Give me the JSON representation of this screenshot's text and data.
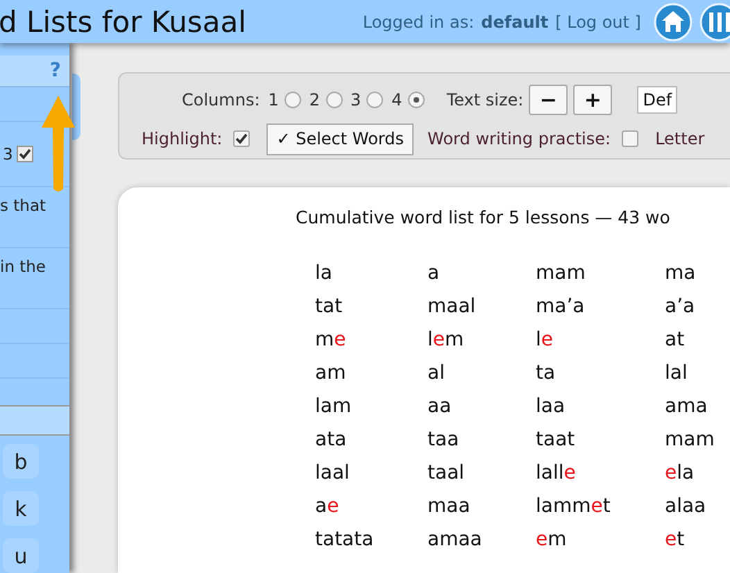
{
  "header": {
    "title": "d Lists for Kusaal",
    "login_label": "Logged in as:",
    "user": "default",
    "logout": "[ Log out ]"
  },
  "sidebar": {
    "help": "?",
    "rows": [
      {
        "kind": "blank"
      },
      {
        "kind": "checkbox",
        "label": "3",
        "checked": true
      },
      {
        "kind": "text",
        "label": "s that"
      },
      {
        "kind": "text",
        "label": "in the"
      },
      {
        "kind": "blank"
      },
      {
        "kind": "blank"
      },
      {
        "kind": "band"
      }
    ],
    "letters": [
      "b",
      "k",
      "u"
    ]
  },
  "toolbar": {
    "columns_label": "Columns:",
    "columns": [
      {
        "label": "1",
        "selected": false
      },
      {
        "label": "2",
        "selected": false
      },
      {
        "label": "3",
        "selected": false
      },
      {
        "label": "4",
        "selected": true
      }
    ],
    "text_size_label": "Text size:",
    "size_buttons": [
      "−",
      "+"
    ],
    "font_select": "Def",
    "highlight_label": "Highlight:",
    "highlight_checked": true,
    "select_words": "✓ Select Words",
    "practise_label": "Word writing practise:",
    "practise_checked": false,
    "letter_label": "Letter"
  },
  "word_list": {
    "title": "Cumulative word list for 5 lessons — 43 wo",
    "rows": [
      [
        [
          {
            "text": "la",
            "highlight": false
          }
        ],
        [
          {
            "text": "a",
            "highlight": false
          }
        ],
        [
          {
            "text": "mam",
            "highlight": false
          }
        ],
        [
          {
            "text": "ma",
            "highlight": false
          }
        ]
      ],
      [
        [
          {
            "text": "tat",
            "highlight": false
          }
        ],
        [
          {
            "text": "maal",
            "highlight": false
          }
        ],
        [
          {
            "text": "ma’a",
            "highlight": false
          }
        ],
        [
          {
            "text": "a’a",
            "highlight": false
          }
        ]
      ],
      [
        [
          {
            "text": "m",
            "highlight": false
          },
          {
            "text": "e",
            "highlight": true
          }
        ],
        [
          {
            "text": "l",
            "highlight": false
          },
          {
            "text": "e",
            "highlight": true
          },
          {
            "text": "m",
            "highlight": false
          }
        ],
        [
          {
            "text": "l",
            "highlight": false
          },
          {
            "text": "e",
            "highlight": true
          }
        ],
        [
          {
            "text": "at",
            "highlight": false
          }
        ]
      ],
      [
        [
          {
            "text": "am",
            "highlight": false
          }
        ],
        [
          {
            "text": "al",
            "highlight": false
          }
        ],
        [
          {
            "text": "ta",
            "highlight": false
          }
        ],
        [
          {
            "text": "lal",
            "highlight": false
          }
        ]
      ],
      [
        [
          {
            "text": "lam",
            "highlight": false
          }
        ],
        [
          {
            "text": "aa",
            "highlight": false
          }
        ],
        [
          {
            "text": "laa",
            "highlight": false
          }
        ],
        [
          {
            "text": "ama",
            "highlight": false
          }
        ]
      ],
      [
        [
          {
            "text": "ata",
            "highlight": false
          }
        ],
        [
          {
            "text": "taa",
            "highlight": false
          }
        ],
        [
          {
            "text": "taat",
            "highlight": false
          }
        ],
        [
          {
            "text": "mam",
            "highlight": false
          }
        ]
      ],
      [
        [
          {
            "text": "laal",
            "highlight": false
          }
        ],
        [
          {
            "text": "taal",
            "highlight": false
          }
        ],
        [
          {
            "text": "lall",
            "highlight": false
          },
          {
            "text": "e",
            "highlight": true
          }
        ],
        [
          {
            "text": "e",
            "highlight": true
          },
          {
            "text": "la",
            "highlight": false
          }
        ]
      ],
      [
        [
          {
            "text": "a",
            "highlight": false
          },
          {
            "text": "e",
            "highlight": true
          }
        ],
        [
          {
            "text": "maa",
            "highlight": false
          }
        ],
        [
          {
            "text": "lamm",
            "highlight": false
          },
          {
            "text": "e",
            "highlight": true
          },
          {
            "text": "t",
            "highlight": false
          }
        ],
        [
          {
            "text": "alaa",
            "highlight": false
          }
        ]
      ],
      [
        [
          {
            "text": "tatata",
            "highlight": false
          }
        ],
        [
          {
            "text": "amaa",
            "highlight": false
          }
        ],
        [
          {
            "text": "e",
            "highlight": true
          },
          {
            "text": "m",
            "highlight": false
          }
        ],
        [
          {
            "text": "e",
            "highlight": true
          },
          {
            "text": "t",
            "highlight": false
          }
        ]
      ]
    ]
  }
}
